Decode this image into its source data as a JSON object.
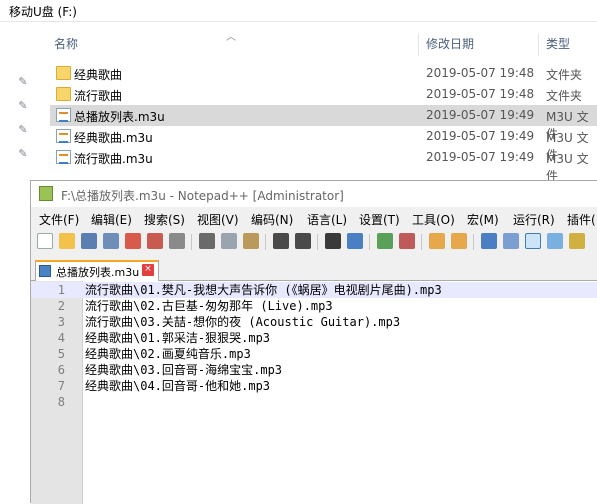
{
  "explorer": {
    "title": "移动U盘 (F:)",
    "columns": {
      "name": "名称",
      "date": "修改日期",
      "type": "类型"
    },
    "files": [
      {
        "name": "经典歌曲",
        "date": "2019-05-07 19:48",
        "type": "文件夹",
        "kind": "folder"
      },
      {
        "name": "流行歌曲",
        "date": "2019-05-07 19:48",
        "type": "文件夹",
        "kind": "folder"
      },
      {
        "name": "总播放列表.m3u",
        "date": "2019-05-07 19:49",
        "type": "M3U 文件",
        "kind": "m3u",
        "selected": true
      },
      {
        "name": "经典歌曲.m3u",
        "date": "2019-05-07 19:49",
        "type": "M3U 文件",
        "kind": "m3u"
      },
      {
        "name": "流行歌曲.m3u",
        "date": "2019-05-07 19:49",
        "type": "M3U 文件",
        "kind": "m3u"
      }
    ],
    "pins": [
      "pin-icon",
      "pin-icon",
      "pin-icon",
      "pin-icon"
    ]
  },
  "notepad": {
    "title": "F:\\总播放列表.m3u - Notepad++ [Administrator]",
    "menus": [
      "文件(F)",
      "编辑(E)",
      "搜索(S)",
      "视图(V)",
      "编码(N)",
      "语言(L)",
      "设置(T)",
      "工具(O)",
      "宏(M)",
      "运行(R)",
      "插件("
    ],
    "tab_label": "总播放列表.m3u",
    "tab_close": "×",
    "lines": [
      {
        "num": "1",
        "text": "流行歌曲\\01.樊凡-我想大声告诉你 (《蜗居》电视剧片尾曲).mp3"
      },
      {
        "num": "2",
        "text": "流行歌曲\\02.古巨基-匆匆那年 (Live).mp3"
      },
      {
        "num": "3",
        "text": "流行歌曲\\03.关喆-想你的夜 (Acoustic Guitar).mp3"
      },
      {
        "num": "4",
        "text": "经典歌曲\\01.郭采洁-狠狠哭.mp3"
      },
      {
        "num": "5",
        "text": "经典歌曲\\02.画夏纯音乐.mp3"
      },
      {
        "num": "6",
        "text": "经典歌曲\\03.回音哥-海绵宝宝.mp3"
      },
      {
        "num": "7",
        "text": "经典歌曲\\04.回音哥-他和她.mp3"
      },
      {
        "num": "8",
        "text": ""
      }
    ]
  }
}
